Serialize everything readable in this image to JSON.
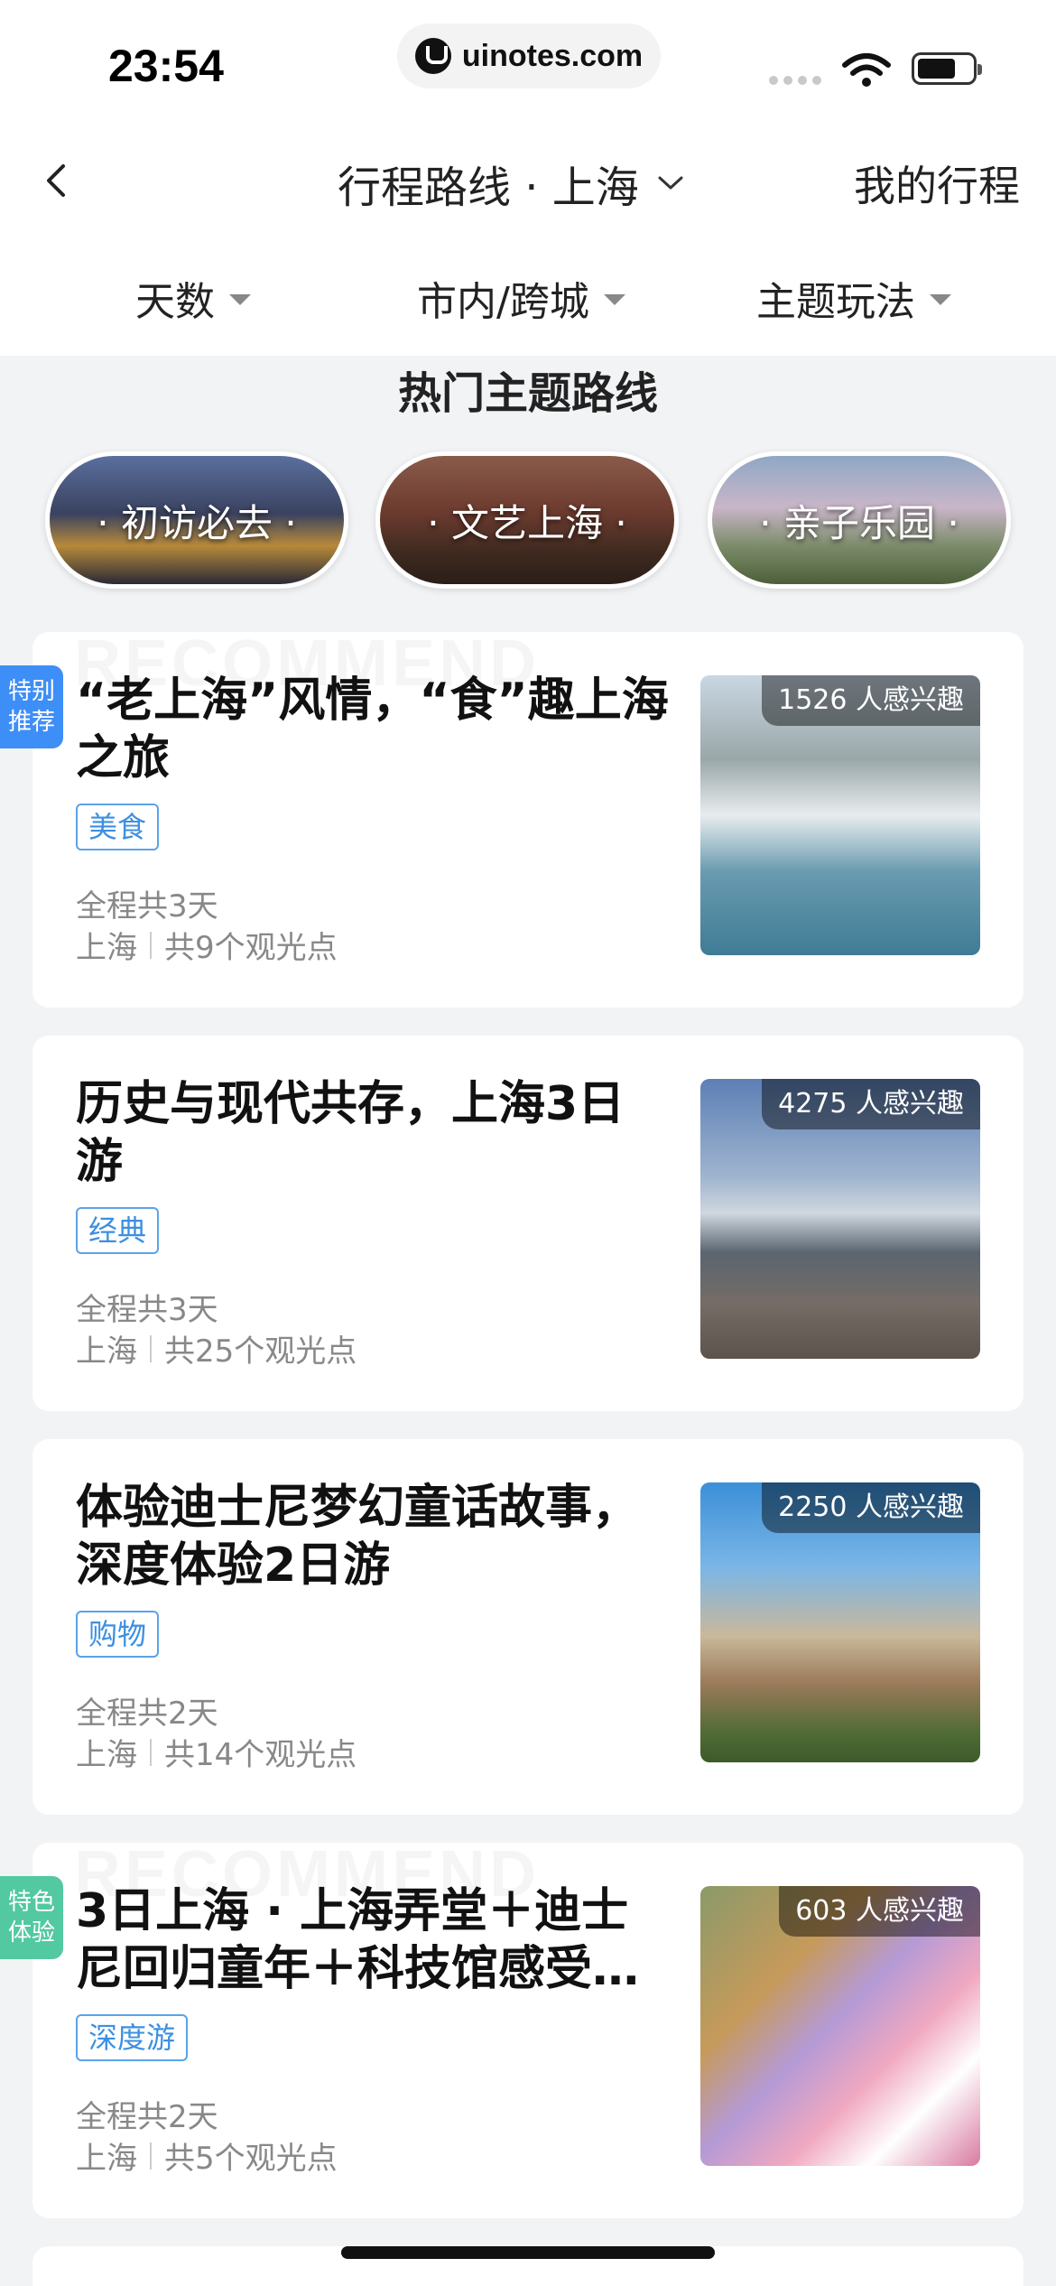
{
  "status_bar": {
    "time": "23:54",
    "url": "uinotes.com"
  },
  "nav": {
    "back_icon": "chevron-left-icon",
    "title": "行程路线 · 上海",
    "title_icon": "chevron-down-icon",
    "right_link": "我的行程"
  },
  "filters": [
    {
      "label": "天数"
    },
    {
      "label": "市内/跨城"
    },
    {
      "label": "主题玩法"
    }
  ],
  "section": {
    "title": "热门主题路线"
  },
  "themes": [
    {
      "label": "· 初访必去 ·"
    },
    {
      "label": "· 文艺上海 ·"
    },
    {
      "label": "· 亲子乐园 ·"
    }
  ],
  "routes": [
    {
      "ribbon": "特别\n推荐",
      "ribbon_color": "#3e8ef7",
      "title": "“老上海”风情，“食”趣上海之旅",
      "tag": "美食",
      "duration": "全程共3天",
      "city": "上海",
      "spots": "共9个观光点",
      "interest": "1526 人感兴趣"
    },
    {
      "ribbon": "",
      "title": "历史与现代共存，上海3日游",
      "tag": "经典",
      "duration": "全程共3天",
      "city": "上海",
      "spots": "共25个观光点",
      "interest": "4275 人感兴趣"
    },
    {
      "ribbon": "",
      "title": "体验迪士尼梦幻童话故事，深度体验2日游",
      "tag": "购物",
      "duration": "全程共2天",
      "city": "上海",
      "spots": "共14个观光点",
      "interest": "2250 人感兴趣"
    },
    {
      "ribbon": "特色\n体验",
      "ribbon_color": "#52c9a0",
      "title": "3日上海 · 上海弄堂＋迪士尼回归童年＋科技馆感受新…",
      "tag": "深度游",
      "duration": "全程共2天",
      "city": "上海",
      "spots": "共5个观光点",
      "interest": "603 人感兴趣"
    }
  ],
  "colors": {
    "accent": "#3d8fe0",
    "background": "#f2f3f5"
  }
}
